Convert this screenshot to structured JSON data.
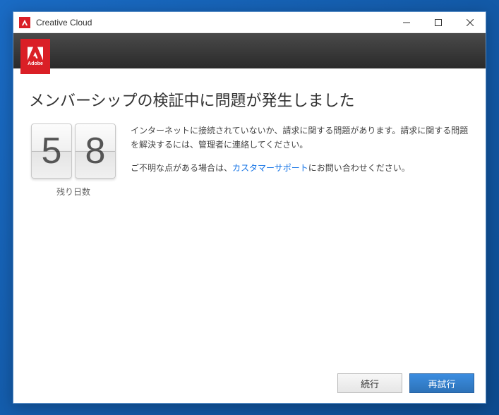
{
  "window": {
    "title": "Creative Cloud"
  },
  "adobe": {
    "label": "Adobe"
  },
  "heading": "メンバーシップの検証中に問題が発生しました",
  "counter": {
    "digit1": "5",
    "digit2": "8",
    "label": "残り日数"
  },
  "message": {
    "p1": "インターネットに接続されていないか、請求に関する問題があります。請求に関する問題を解決するには、管理者に連絡してください。",
    "p2_before": "ご不明な点がある場合は、",
    "p2_link": "カスタマーサポート",
    "p2_after": "にお問い合わせください。"
  },
  "buttons": {
    "continue": "続行",
    "retry": "再試行"
  }
}
